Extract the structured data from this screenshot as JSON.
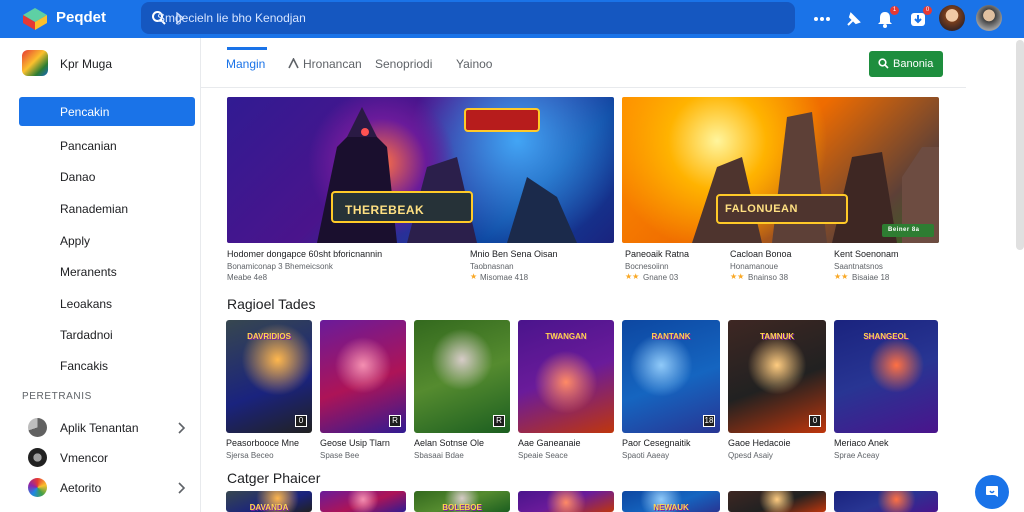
{
  "topbar": {
    "brand": "Peqdet",
    "search_text": "Smgecieln lie bho Kenodjan",
    "badges": [
      "1",
      "0",
      "4"
    ]
  },
  "account": {
    "name": "Kpr Muga"
  },
  "nav": [
    {
      "label": "Pencakin",
      "icon": "store-icon",
      "active": true
    },
    {
      "label": "Pancanian",
      "icon": "folder-icon",
      "active": false
    },
    {
      "label": "Danao",
      "icon": "compass-icon",
      "active": false
    },
    {
      "label": "Ranademian",
      "icon": "wrench-icon",
      "active": false
    },
    {
      "label": "Apply",
      "icon": "tool-icon",
      "active": false
    },
    {
      "label": "Meranents",
      "icon": "image-icon",
      "active": false
    },
    {
      "label": "Leoakans",
      "icon": "chart-icon",
      "active": false
    },
    {
      "label": "Tardadnoi",
      "icon": "calendar-icon",
      "active": false
    },
    {
      "label": "Fancakis",
      "icon": "circle-icon",
      "active": false
    }
  ],
  "section_heading": "PERETRANIS",
  "apps": [
    {
      "label": "Aplik Tenantan"
    },
    {
      "label": "Vmencor"
    },
    {
      "label": "Aetorito"
    }
  ],
  "tabs": [
    "Mangin",
    "Hronancan",
    "Senopriodi",
    "Yainoo"
  ],
  "cta_label": "Banonia",
  "featured": [
    {
      "overlay_title": "THEREBEAK",
      "title": "Hodomer dongapce 60sht bforicnannin",
      "subtitle": "Bonamiconap 3 Bhemeicsonk",
      "rating": "Meabe 4e8"
    },
    {
      "overlay_title": "FALONUEAN",
      "badge": "Beiner 8a"
    }
  ],
  "featured_meta": [
    {
      "title": "Mnio Ben Sena Oisan",
      "subtitle": "Taobnasnan",
      "rating": "Misomae 418"
    },
    {
      "title": "Paneoaik Ratna",
      "subtitle": "Bocnesoiinn",
      "rating": "Gnane 03"
    },
    {
      "title": "Cacloan Bonoa",
      "subtitle": "Honamanoue",
      "rating": "Bnainso 38"
    },
    {
      "title": "Kent Soenonam",
      "subtitle": "Saantnatsnos",
      "rating": "Bisaiae 18"
    }
  ],
  "row1_title": "Ragioel Tades",
  "row1": [
    {
      "title": "Peasorbooce Mne",
      "subtitle": "Sjersa Beceo",
      "tag": "0",
      "art": "DAVRIDIOS"
    },
    {
      "title": "Geose Usip Tlarn",
      "subtitle": "Spase Bee",
      "tag": "R",
      "art": ""
    },
    {
      "title": "Aelan Sotnse Ole",
      "subtitle": "Sbasaai Bdae",
      "tag": "R",
      "art": ""
    },
    {
      "title": "Aae Ganeanaie",
      "subtitle": "Speaie Seace",
      "tag": "",
      "art": "TWANGAN"
    },
    {
      "title": "Paor Cesegnaitik",
      "subtitle": "Spaoti Aaeay",
      "tag": "18",
      "art": "RANTANK"
    },
    {
      "title": "Gaoe Hedacoie",
      "subtitle": "Qpesd Asaiy",
      "tag": "0",
      "art": "TAMNUK"
    },
    {
      "title": "Meriaco Anek",
      "subtitle": "Sprae Aceay",
      "tag": "",
      "art": "SHANGEOL"
    }
  ],
  "row2_title": "Catger Phaicer",
  "row2": [
    {
      "art": "DAVANDA"
    },
    {
      "art": ""
    },
    {
      "art": "BOLEBOE"
    },
    {
      "art": ""
    },
    {
      "art": "NEWAUK"
    },
    {
      "art": ""
    },
    {
      "art": ""
    }
  ]
}
